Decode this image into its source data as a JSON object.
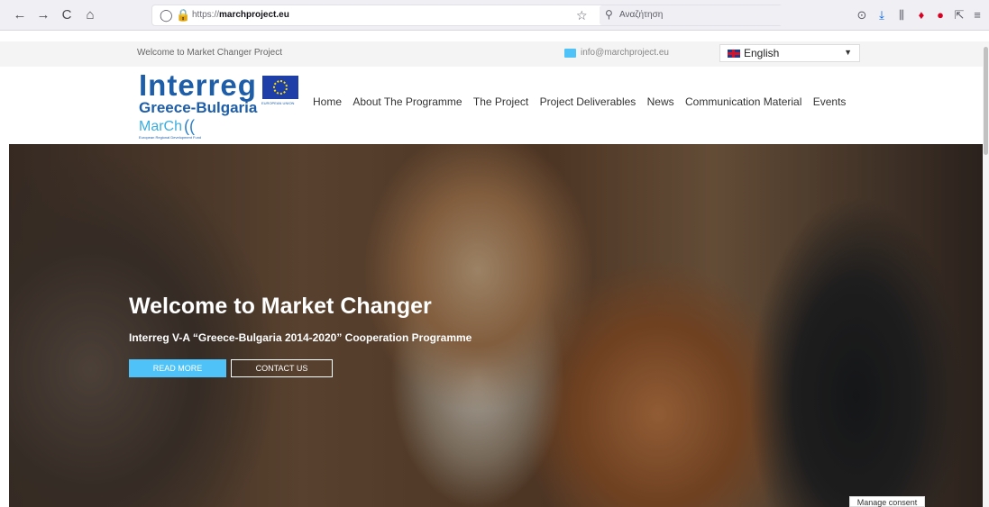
{
  "browser": {
    "back_icon": "←",
    "forward_icon": "→",
    "reload_icon": "C",
    "home_icon": "⌂",
    "shield_icon": "◯",
    "lock_icon": "🔒",
    "url_protocol": "https://",
    "url_domain": "marchproject.eu",
    "star_icon": "☆",
    "search_icon": "⚲",
    "search_placeholder": "Αναζήτηση",
    "pocket_icon": "⊙",
    "download_icon": "⤓",
    "library_icon": "⫼",
    "ext_icon": "♦",
    "ublock_icon": "●",
    "share_icon": "⇱",
    "menu_icon": "≡"
  },
  "topbar": {
    "welcome": "Welcome to Market Changer Project",
    "email": "info@marchproject.eu",
    "language": "English",
    "caret": "▼"
  },
  "logo": {
    "interreg": "Interreg",
    "region": "Greece-Bulgaria",
    "project": "MarCh",
    "swirl": "((",
    "eu_caption": "EUROPEAN UNION",
    "fund": "European Regional Development Fund"
  },
  "nav": {
    "items": [
      "Home",
      "About The Programme",
      "The Project",
      "Project Deliverables",
      "News",
      "Communication Material",
      "Events"
    ]
  },
  "hero": {
    "title": "Welcome to Market Changer",
    "subtitle": "Interreg V-A “Greece-Bulgaria 2014-2020” Cooperation Programme",
    "read_more": "READ MORE",
    "contact_us": "CONTACT US"
  },
  "consent": {
    "label": "Manage consent"
  },
  "colors": {
    "accent": "#4fc3f7",
    "brand": "#1e5ea8"
  }
}
